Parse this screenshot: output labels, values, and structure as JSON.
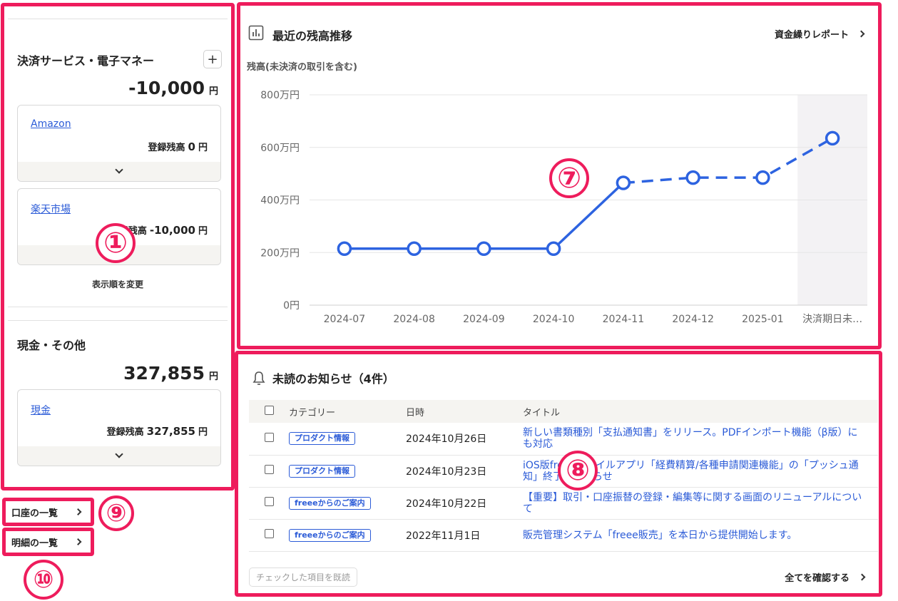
{
  "left": {
    "payment_section": {
      "title": "決済サービス・電子マネー",
      "add_label": "+",
      "total": "-10,000",
      "currency": "円",
      "accounts": [
        {
          "name": "Amazon",
          "balance_label": "登録残高",
          "balance": "0",
          "currency": "円"
        },
        {
          "name": "楽天市場",
          "balance_label": "登録残高",
          "balance": "-10,000",
          "currency": "円"
        }
      ],
      "reorder_label": "表示順を変更"
    },
    "cash_section": {
      "title": "現金・その他",
      "total": "327,855",
      "currency": "円",
      "accounts": [
        {
          "name": "現金",
          "balance_label": "登録残高",
          "balance": "327,855",
          "currency": "円"
        }
      ]
    },
    "nav": {
      "accounts_list": "口座の一覧",
      "statements_list": "明細の一覧"
    }
  },
  "annotations": {
    "n1": "①",
    "n7": "⑦",
    "n8": "⑧",
    "n9": "⑨",
    "n10": "⑩"
  },
  "balance_card": {
    "title": "最近の残高推移",
    "report_link": "資金繰りレポート",
    "subtitle": "残高(未決済の取引を含む)"
  },
  "chart_data": {
    "type": "line",
    "categories": [
      "2024-07",
      "2024-08",
      "2024-09",
      "2024-10",
      "2024-11",
      "2024-12",
      "2025-01",
      "決済期日未…"
    ],
    "y_tick_labels": [
      "800万円",
      "600万円",
      "400万円",
      "200万円",
      "0円"
    ],
    "y_ticks": [
      8000000,
      6000000,
      4000000,
      2000000,
      0
    ],
    "ylim": [
      0,
      8000000
    ],
    "grid": true,
    "series": [
      {
        "values": [
          2150000,
          2150000,
          2150000,
          2150000,
          4650000,
          4850000,
          4850000,
          6350000
        ],
        "solid_until_index": 4,
        "dashed_from_index": 4
      }
    ],
    "highlight_category": "決済期日未…",
    "line_color": "#2d63e0"
  },
  "notices": {
    "title": "未読のお知らせ（4件）",
    "columns": [
      "カテゴリー",
      "日時",
      "タイトル"
    ],
    "rows": [
      {
        "category": "プロダクト情報",
        "date": "2024年10月26日",
        "title": "新しい書類種別「支払通知書」をリリース。PDFインポート機能（β版）にも対応"
      },
      {
        "category": "プロダクト情報",
        "date": "2024年10月23日",
        "title": "iOS版freeeモバイルアプリ「経費精算/各種申請関連機能」の「プッシュ通知」終了のお知らせ"
      },
      {
        "category": "freeeからのご案内",
        "date": "2024年10月22日",
        "title": "【重要】取引・口座振替の登録・編集等に関する画面のリニューアルについて"
      },
      {
        "category": "freeeからのご案内",
        "date": "2022年11月1日",
        "title": "販売管理システム「freee販売」を本日から提供開始します。"
      }
    ],
    "mark_read_label": "チェックした項目を既読",
    "view_all_label": "全てを確認する"
  },
  "colors": {
    "frame": "#ee1c5c",
    "link": "#2b5bd7",
    "line": "#2d63e0"
  }
}
